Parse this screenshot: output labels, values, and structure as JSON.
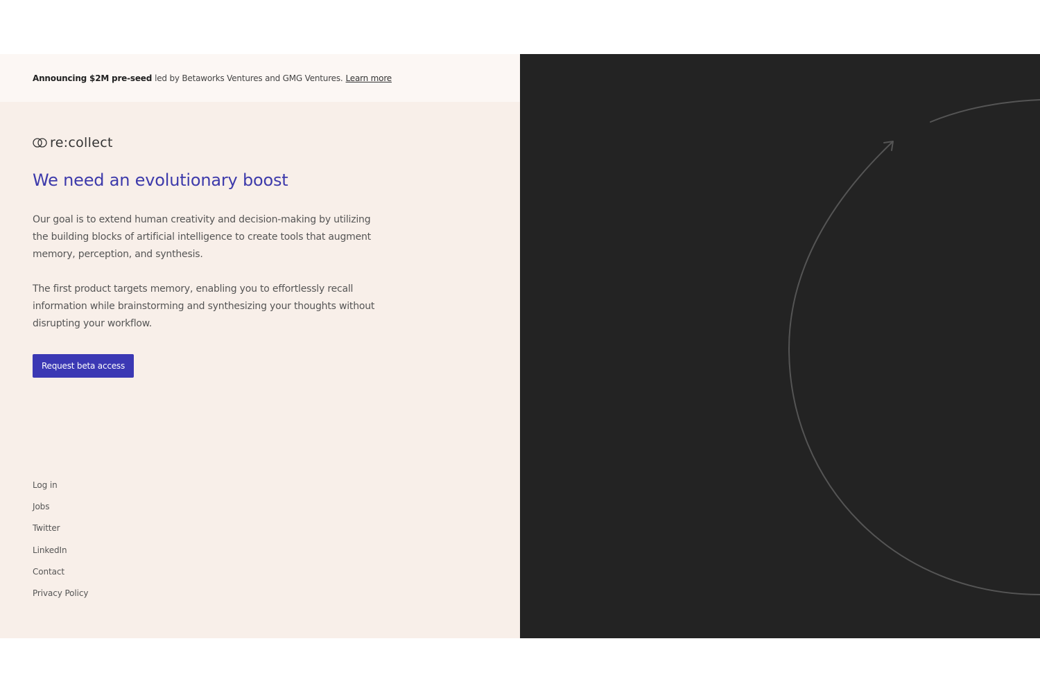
{
  "announcement": {
    "strong": "Announcing $2M pre-seed",
    "text": "led by Betaworks Ventures and GMG Ventures.",
    "link": "Learn more"
  },
  "brand": {
    "logo_icon": "two-circles-icon",
    "wordmark": "re:collect"
  },
  "hero": {
    "headline": "We need an evolutionary boost",
    "paragraph1": "Our goal is to extend human creativity and decision-making by utilizing the building blocks of artificial intelligence to create tools that augment memory, perception, and synthesis.",
    "paragraph2": "The first product targets memory, enabling you to effortlessly recall information while brainstorming and synthesizing your thoughts without disrupting your workflow.",
    "cta_label": "Request beta access"
  },
  "footer": {
    "links": [
      "Log in",
      "Jobs",
      "Twitter",
      "LinkedIn",
      "Contact",
      "Privacy Policy"
    ]
  },
  "colors": {
    "accent": "#3d3aab",
    "button": "#3b38b4",
    "left_panel": "#f8efe9",
    "announcement_bar": "#fcf7f4",
    "right_panel": "#232323",
    "arc_stroke": "#555555"
  },
  "decoration": {
    "icon": "circular-arrow-icon"
  }
}
